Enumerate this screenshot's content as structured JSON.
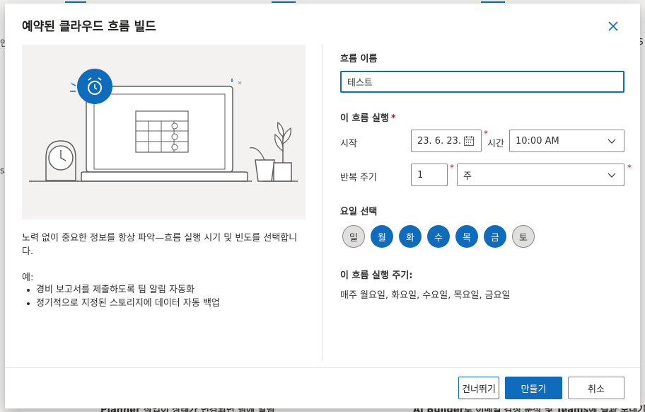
{
  "background": {
    "bottom_left_text": "Planner 작업이 상태가 변경되면 팀에 알림",
    "bottom_right_text": "AI Builder로 이메일 감정 분석 및 Teams에 결과 보내기",
    "edge_left_top": "인",
    "edge_left_mid": "s",
    "edge_right_top": "S"
  },
  "dialog": {
    "title": "예약된 클라우드 흐름 빌드",
    "close_label": "닫기"
  },
  "left": {
    "description": "노력 없이 중요한 정보를 항상 파악—흐름 실행 시기 및 빈도를 선택합니다.",
    "example_label": "예:",
    "examples": [
      "경비 보고서를 제출하도록 팀 알림 자동화",
      "정기적으로 지정된 스토리지에 데이터 자동 백업"
    ]
  },
  "form": {
    "flow_name_label": "흐름 이름",
    "flow_name_value": "테스트",
    "run_label": "이 흐름 실행",
    "required_mark": "*",
    "start_label": "시작",
    "start_date": "23. 6. 23.",
    "time_label": "시간",
    "start_time": "10:00 AM",
    "repeat_label": "반복 주기",
    "repeat_interval": "1",
    "repeat_unit": "주",
    "weekday_label": "요일 선택",
    "weekdays": [
      {
        "label": "일",
        "selected": false
      },
      {
        "label": "월",
        "selected": true
      },
      {
        "label": "화",
        "selected": true
      },
      {
        "label": "수",
        "selected": true
      },
      {
        "label": "목",
        "selected": true
      },
      {
        "label": "금",
        "selected": true
      },
      {
        "label": "토",
        "selected": false
      }
    ],
    "summary_label": "이 흐름 실행 주기:",
    "summary_value": "매주 월요일, 화요일, 수요일, 목요일, 금요일"
  },
  "footer": {
    "skip_label": "건너뛰기",
    "create_label": "만들기",
    "cancel_label": "취소"
  },
  "colors": {
    "accent": "#0f6cbd",
    "required": "#a4262c",
    "day_off_bg": "#e1dfdd"
  },
  "icons": {
    "close": "close-icon",
    "calendar": "calendar-icon",
    "dropdown": "chevron-down-icon",
    "alarm": "alarm-clock-icon"
  }
}
